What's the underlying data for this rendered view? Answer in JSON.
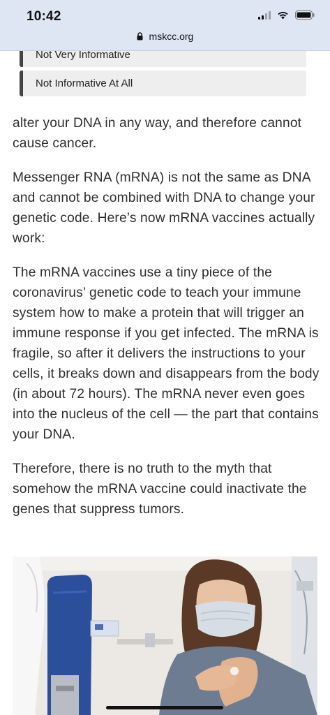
{
  "status_bar": {
    "time": "10:42",
    "icons": [
      "cellular-signal-icon",
      "wifi-icon",
      "battery-icon"
    ]
  },
  "browser": {
    "url": "mskcc.org",
    "lock_icon": "lock-icon"
  },
  "poll": {
    "options": [
      "Not Very Informative",
      "Not Informative At All"
    ]
  },
  "article": {
    "paragraphs": [
      "alter your DNA in any way, and therefore cannot cause cancer.",
      "Messenger RNA (mRNA) is not the same as DNA and cannot be combined with DNA to change your genetic code. Here’s now mRNA vaccines actually work:",
      "The mRNA vaccines use a tiny piece of the coronavirus’ genetic code to teach your immune system how to make a protein that will trigger an immune response if you get infected. The mRNA is fragile, so after it delivers the instructions to your cells, it breaks down and disappears from the body (in about 72 hours). The mRNA never even goes into the nucleus of the cell — the part that contains your DNA.",
      "Therefore, there is no truth to the myth that somehow the mRNA vaccine could inactivate the genes that suppress tumors."
    ]
  },
  "photo": {
    "subject": "woman-wearing-mask-receiving-vaccine"
  },
  "colors": {
    "topbar": "#dfe6f3",
    "text": "#2f2f2f",
    "poll_bg": "#eeeeee",
    "poll_accent": "#444444"
  }
}
